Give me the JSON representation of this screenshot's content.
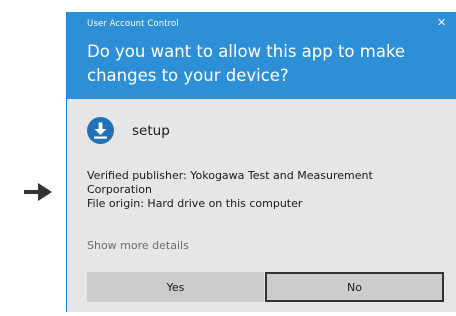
{
  "dialog": {
    "title": "User Account Control",
    "close_icon": "close-icon",
    "question": "Do you want to allow this app to make changes to your device?",
    "app_name": "setup",
    "app_icon": "download-icon",
    "publisher_line_1": "Verified publisher: Yokogawa Test and Measurement",
    "publisher_line_2": "Corporation",
    "file_origin": "File origin: Hard drive on this computer",
    "show_more_details": "Show more details",
    "yes_label": "Yes",
    "no_label": "No"
  },
  "annotation": {
    "pointer": "right-arrow-icon"
  },
  "colors": {
    "header": "#2d90d6",
    "body": "#e6e6e6",
    "button": "#cccccc",
    "icon": "#1f72b5"
  }
}
